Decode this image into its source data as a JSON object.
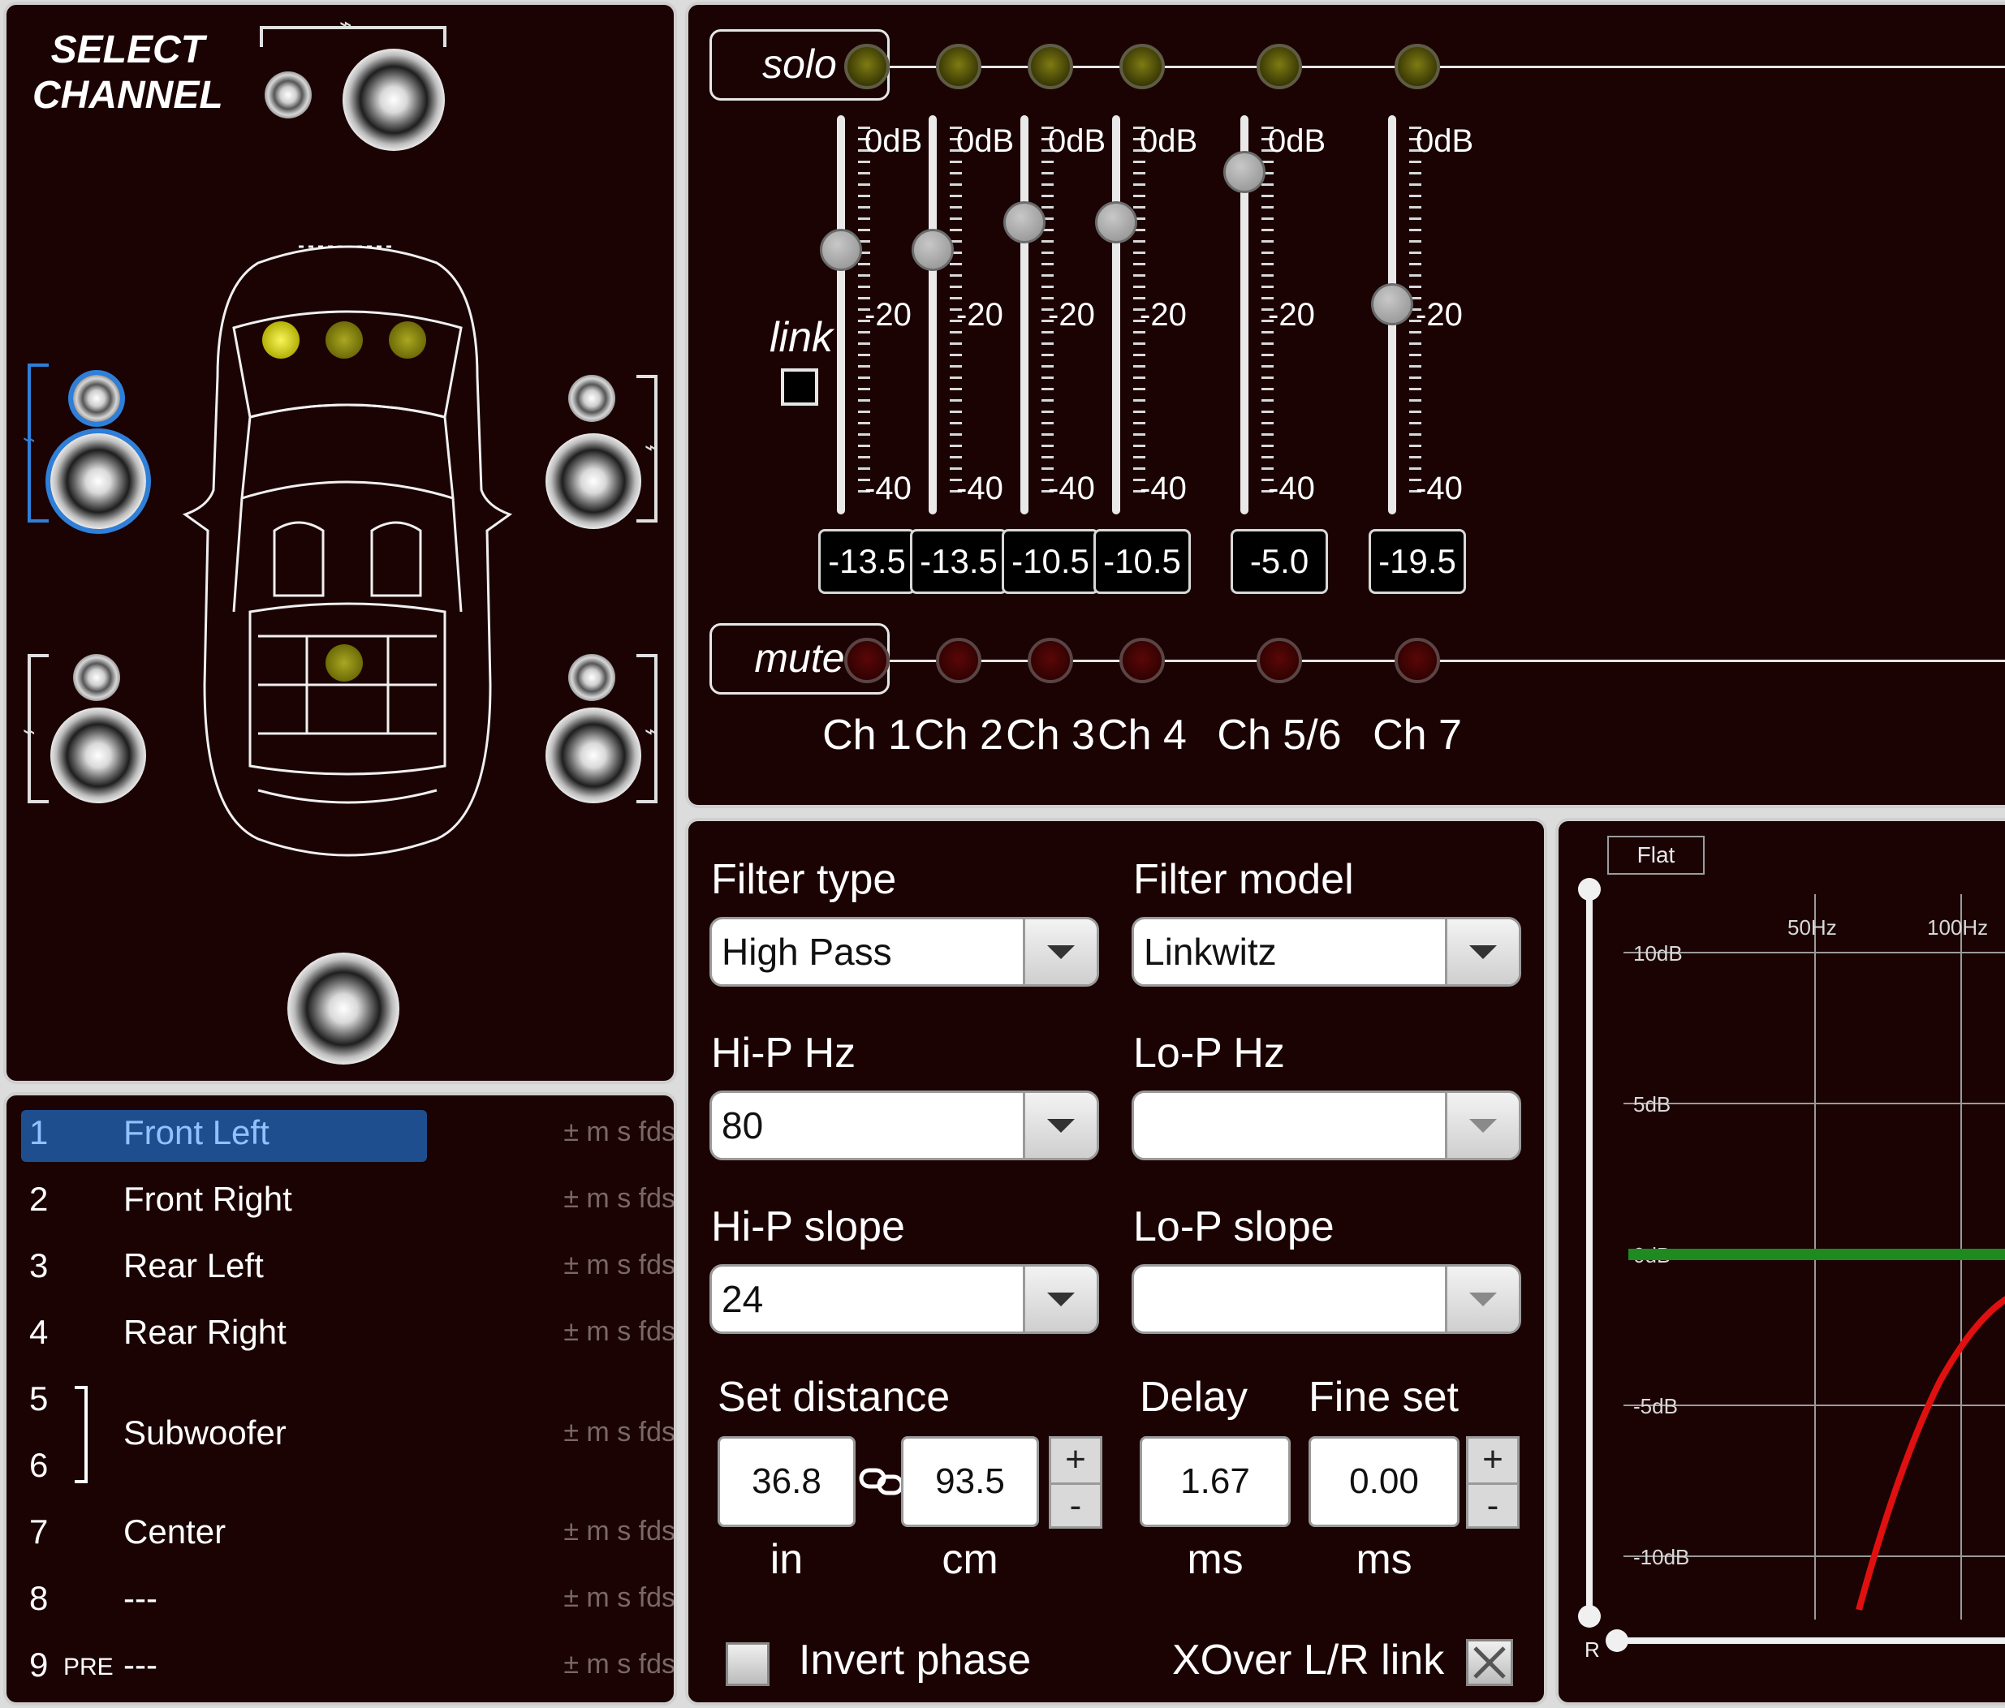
{
  "select_channel": {
    "line1": "SELECT",
    "line2": "CHANNEL"
  },
  "mixer": {
    "solo_label": "solo",
    "mute_label": "mute",
    "link_label": "link",
    "scale": [
      "0dB",
      "-20",
      "-40"
    ],
    "channels": [
      {
        "name": "Ch 1",
        "value": "-13.5",
        "level_db": -13.5
      },
      {
        "name": "Ch 2",
        "value": "-13.5",
        "level_db": -13.5
      },
      {
        "name": "Ch 3",
        "value": "-10.5",
        "level_db": -10.5
      },
      {
        "name": "Ch 4",
        "value": "-10.5",
        "level_db": -10.5
      },
      {
        "name": "Ch 5/6",
        "value": "-5.0",
        "level_db": -5.0
      },
      {
        "name": "Ch 7",
        "value": "-19.5",
        "level_db": -19.5
      }
    ]
  },
  "channel_list": [
    {
      "num": "1",
      "name": "Front Left",
      "suffix": "± m s fds",
      "selected": true
    },
    {
      "num": "2",
      "name": "Front Right",
      "suffix": "± m s fds"
    },
    {
      "num": "3",
      "name": "Rear Left",
      "suffix": "± m s fds"
    },
    {
      "num": "4",
      "name": "Rear Right",
      "suffix": "± m s fds"
    },
    {
      "num": "5",
      "name": "",
      "suffix": ""
    },
    {
      "num": "6",
      "name": "",
      "suffix": ""
    },
    {
      "num": "7",
      "name": "Center",
      "suffix": "± m s fds"
    },
    {
      "num": "8",
      "name": "---",
      "suffix": "± m s fds"
    },
    {
      "num": "9",
      "name": "---",
      "suffix": "± m s fds",
      "pre": "PRE"
    }
  ],
  "subwoofer": {
    "name": "Subwoofer",
    "suffix": "± m s fds"
  },
  "filter": {
    "type_label": "Filter type",
    "type_value": "High Pass",
    "model_label": "Filter model",
    "model_value": "Linkwitz",
    "hip_hz_label": "Hi-P Hz",
    "hip_hz_value": "80",
    "lop_hz_label": "Lo-P Hz",
    "lop_hz_value": "",
    "hip_slope_label": "Hi-P slope",
    "hip_slope_value": "24",
    "lop_slope_label": "Lo-P slope",
    "lop_slope_value": "",
    "distance_label": "Set distance",
    "distance_in": "36.8",
    "distance_cm": "93.5",
    "unit_in": "in",
    "unit_cm": "cm",
    "delay_label": "Delay",
    "delay_value": "1.67",
    "delay_unit": "ms",
    "fine_label": "Fine set",
    "fine_value": "0.00",
    "fine_unit": "ms",
    "plus": "+",
    "minus": "-",
    "invert_label": "Invert phase",
    "invert_checked": false,
    "xover_label": "XOver L/R link",
    "xover_checked": true
  },
  "eq_graph": {
    "flat_button": "Flat",
    "y_ticks": [
      "10dB",
      "5dB",
      "0dB",
      "-5dB",
      "-10dB"
    ],
    "x_ticks": [
      "50Hz",
      "100Hz"
    ],
    "r_label": "R",
    "line_colors": {
      "flat": "#1f8a1f",
      "response": "#e01010"
    }
  }
}
